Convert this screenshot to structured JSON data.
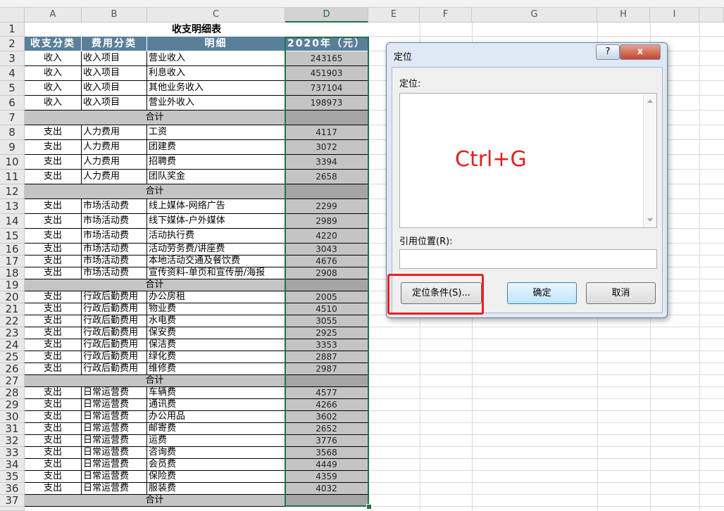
{
  "columns": [
    "A",
    "B",
    "C",
    "D",
    "E",
    "F",
    "G",
    "H",
    "I"
  ],
  "title": "收支明细表",
  "headers": [
    "收支分类",
    "费用分类",
    "明细",
    "2020年（元）"
  ],
  "rows": [
    {
      "n": "3",
      "a": "收入",
      "b": "收入项目",
      "c": "营业收入",
      "d": "243165"
    },
    {
      "n": "4",
      "a": "收入",
      "b": "收入项目",
      "c": "利息收入",
      "d": "451903"
    },
    {
      "n": "5",
      "a": "收入",
      "b": "收入项目",
      "c": "其他业务收入",
      "d": "737104"
    },
    {
      "n": "6",
      "a": "收入",
      "b": "收入项目",
      "c": "营业外收入",
      "d": "198973"
    },
    {
      "n": "7",
      "sum": "合计"
    },
    {
      "n": "8",
      "a": "支出",
      "b": "人力费用",
      "c": "工资",
      "d": "4117"
    },
    {
      "n": "9",
      "a": "支出",
      "b": "人力费用",
      "c": "团建费",
      "d": "3072"
    },
    {
      "n": "10",
      "a": "支出",
      "b": "人力费用",
      "c": "招聘费",
      "d": "3394"
    },
    {
      "n": "11",
      "a": "支出",
      "b": "人力费用",
      "c": "团队奖金",
      "d": "2658"
    },
    {
      "n": "12",
      "sum": "合计"
    },
    {
      "n": "13",
      "a": "支出",
      "b": "市场活动费",
      "c": "线上媒体-网络广告",
      "d": "2299"
    },
    {
      "n": "14",
      "a": "支出",
      "b": "市场活动费",
      "c": "线下媒体-户外媒体",
      "d": "2989"
    },
    {
      "n": "15",
      "a": "支出",
      "b": "市场活动费",
      "c": "活动执行费",
      "d": "4220"
    },
    {
      "n": "16",
      "a": "支出",
      "b": "市场活动费",
      "c": "活动劳务费/讲座费",
      "d": "3043"
    },
    {
      "n": "17",
      "a": "支出",
      "b": "市场活动费",
      "c": "本地活动交通及餐饮费",
      "d": "4676"
    },
    {
      "n": "18",
      "a": "支出",
      "b": "市场活动费",
      "c": "宣传资料-单页和宣传册/海报",
      "d": "2908"
    },
    {
      "n": "19",
      "sum": "合计"
    },
    {
      "n": "20",
      "a": "支出",
      "b": "行政后勤费用",
      "c": "办公房租",
      "d": "2005"
    },
    {
      "n": "21",
      "a": "支出",
      "b": "行政后勤费用",
      "c": "物业费",
      "d": "4510"
    },
    {
      "n": "22",
      "a": "支出",
      "b": "行政后勤费用",
      "c": "水电费",
      "d": "3055"
    },
    {
      "n": "23",
      "a": "支出",
      "b": "行政后勤费用",
      "c": "保安费",
      "d": "2925"
    },
    {
      "n": "24",
      "a": "支出",
      "b": "行政后勤费用",
      "c": "保洁费",
      "d": "3353"
    },
    {
      "n": "25",
      "a": "支出",
      "b": "行政后勤费用",
      "c": "绿化费",
      "d": "2887"
    },
    {
      "n": "26",
      "a": "支出",
      "b": "行政后勤费用",
      "c": "维修费",
      "d": "2987"
    },
    {
      "n": "27",
      "sum": "合计"
    },
    {
      "n": "28",
      "a": "支出",
      "b": "日常运营费",
      "c": "车辆费",
      "d": "4577"
    },
    {
      "n": "29",
      "a": "支出",
      "b": "日常运营费",
      "c": "通讯费",
      "d": "4266"
    },
    {
      "n": "30",
      "a": "支出",
      "b": "日常运营费",
      "c": "办公用品",
      "d": "3602"
    },
    {
      "n": "31",
      "a": "支出",
      "b": "日常运营费",
      "c": "邮寄费",
      "d": "2652"
    },
    {
      "n": "32",
      "a": "支出",
      "b": "日常运营费",
      "c": "运费",
      "d": "3776"
    },
    {
      "n": "33",
      "a": "支出",
      "b": "日常运营费",
      "c": "咨询费",
      "d": "3568"
    },
    {
      "n": "34",
      "a": "支出",
      "b": "日常运营费",
      "c": "会员费",
      "d": "4449"
    },
    {
      "n": "35",
      "a": "支出",
      "b": "日常运营费",
      "c": "保险费",
      "d": "4359"
    },
    {
      "n": "36",
      "a": "支出",
      "b": "日常运营费",
      "c": "服装费",
      "d": "4032"
    },
    {
      "n": "37",
      "sum": "合计"
    }
  ],
  "dialog": {
    "title": "定位",
    "help_label": "?",
    "close_label": "x",
    "goto_label": "定位:",
    "annotation": "Ctrl+G",
    "reference_label": "引用位置(R):",
    "reference_value": "",
    "special_button": "定位条件(S)...",
    "ok_button": "确定",
    "cancel_button": "取消"
  },
  "colors": {
    "header_fill": "#5a7f99",
    "selection": "#217346",
    "highlight": "#e8231f",
    "annotation": "#e0201e"
  }
}
